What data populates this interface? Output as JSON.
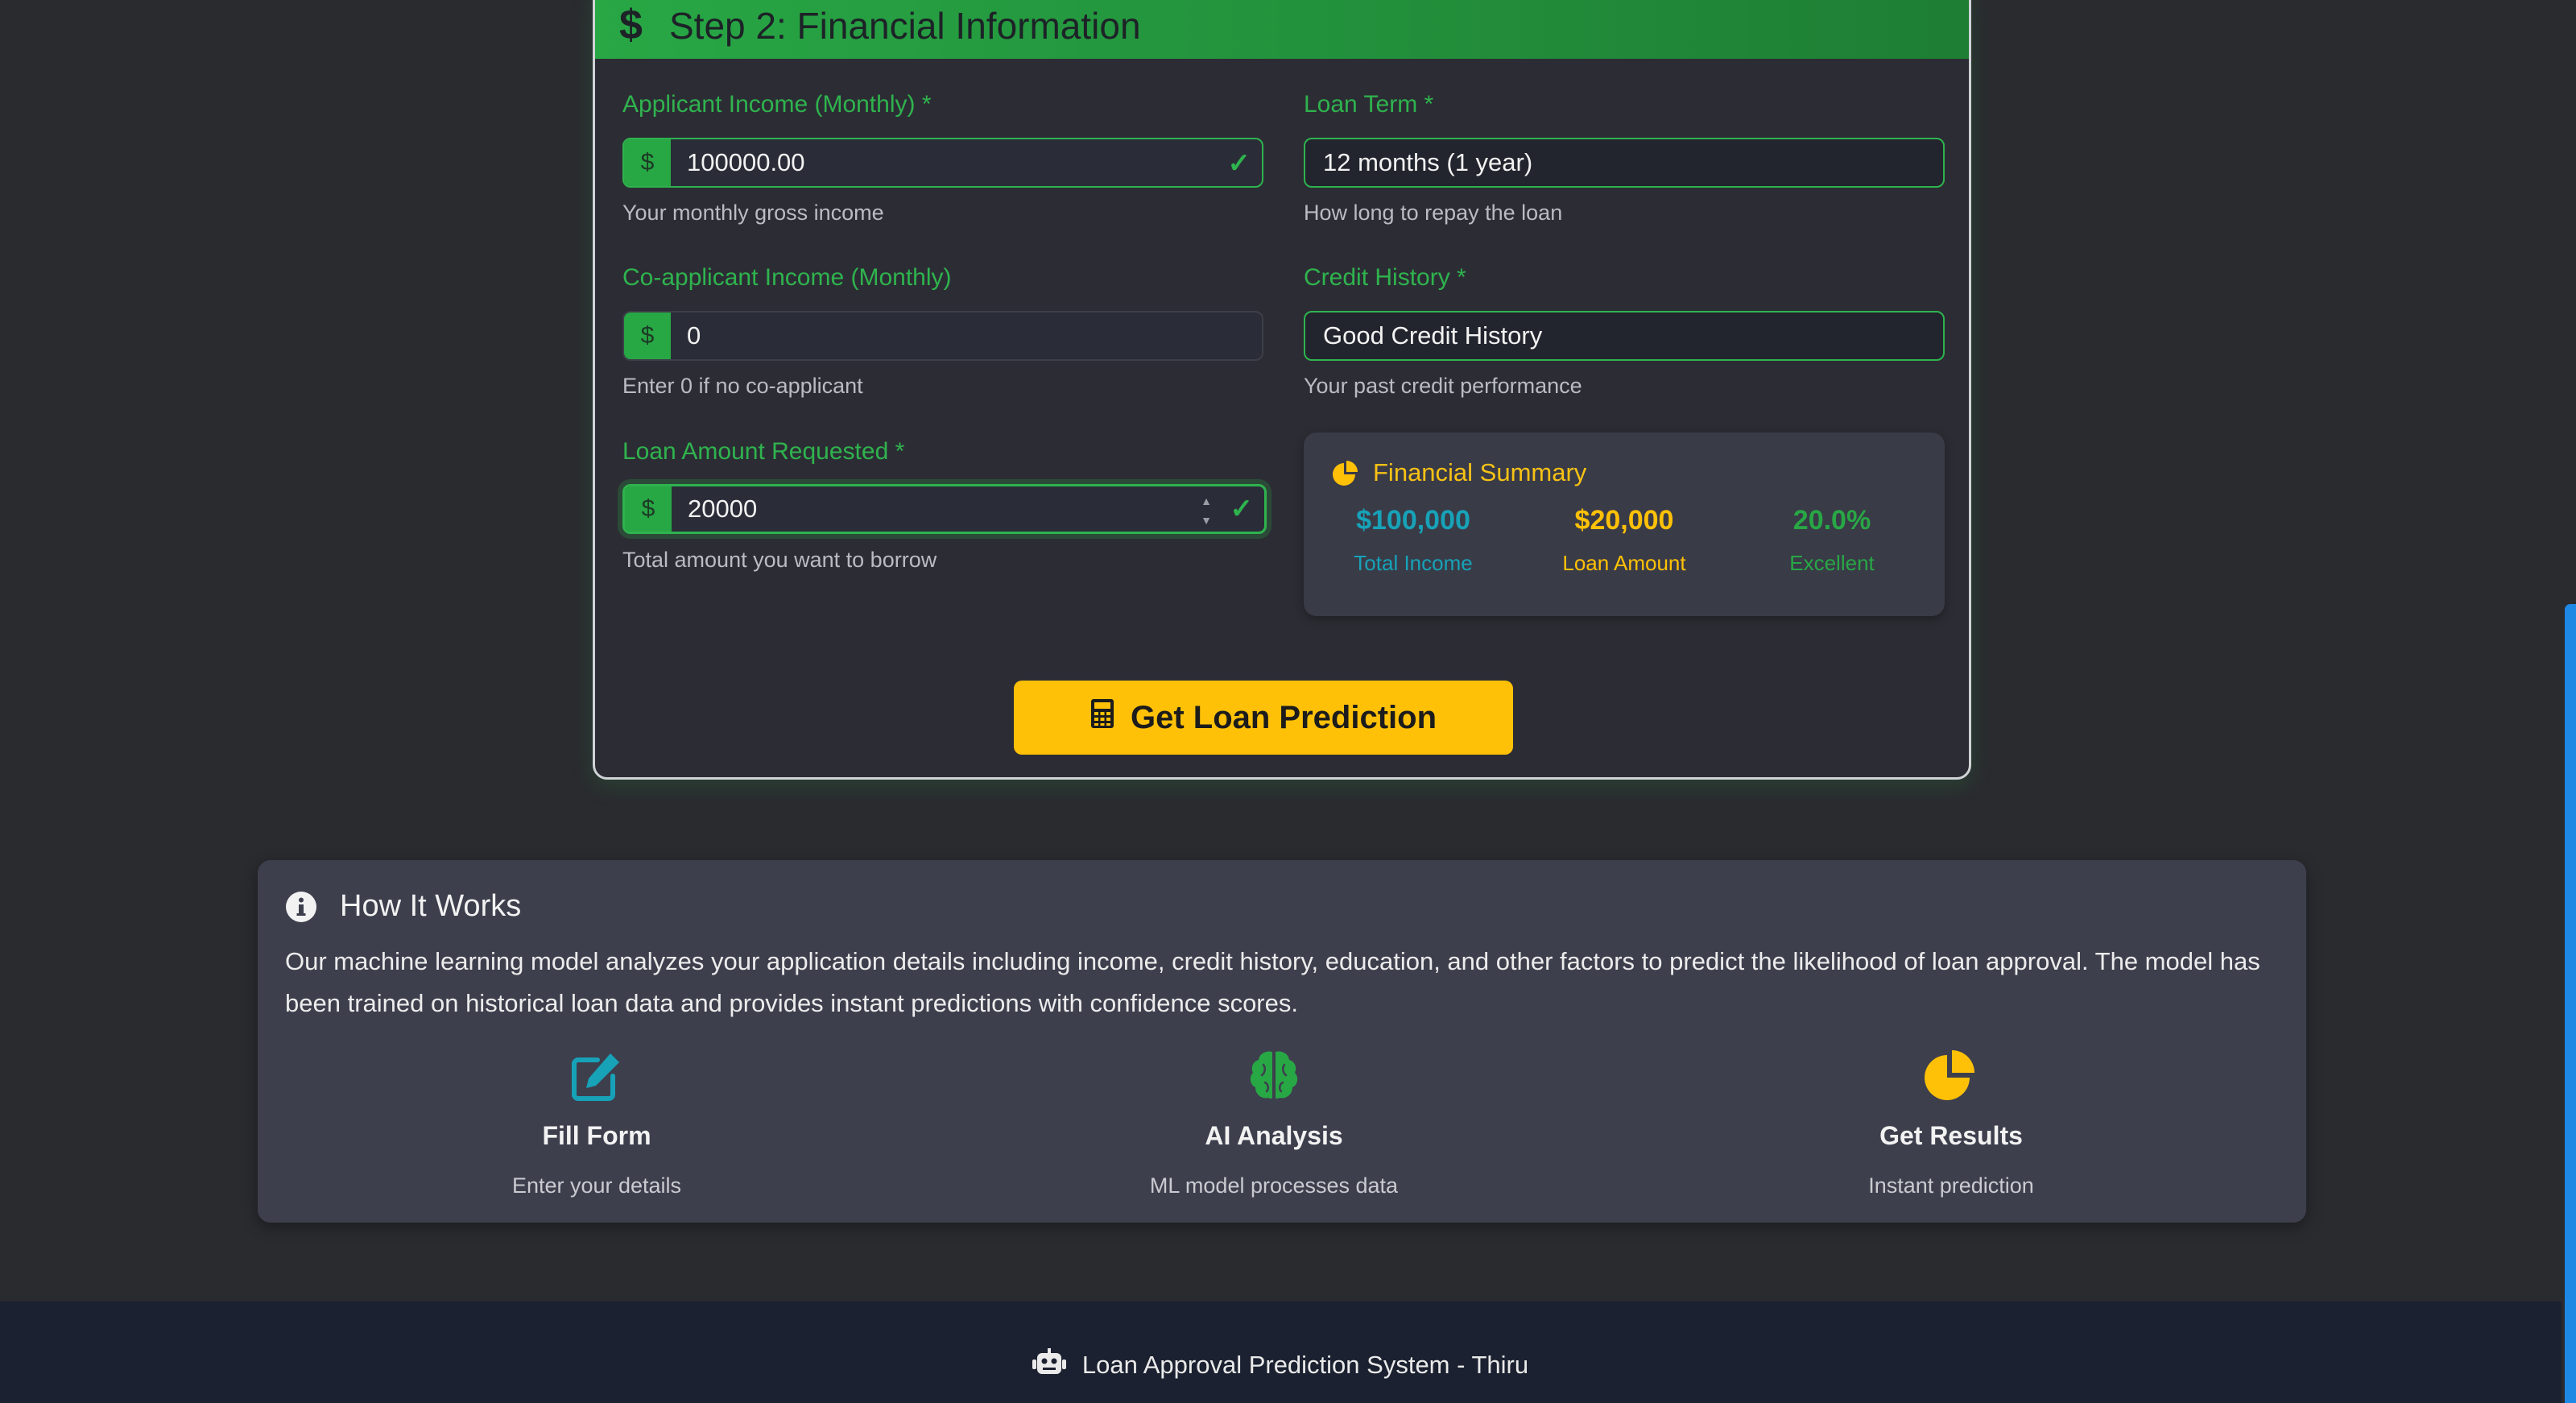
{
  "step": {
    "icon": "dollar-sign-icon",
    "title": "Step 2: Financial Information"
  },
  "form": {
    "applicant_income": {
      "label": "Applicant Income (Monthly) *",
      "prefix": "$",
      "value": "100000.00",
      "help": "Your monthly gross income"
    },
    "coapplicant_income": {
      "label": "Co-applicant Income (Monthly)",
      "prefix": "$",
      "value": "0",
      "help": "Enter 0 if no co-applicant"
    },
    "loan_amount": {
      "label": "Loan Amount Requested *",
      "prefix": "$",
      "value": "20000",
      "help": "Total amount you want to borrow"
    },
    "loan_term": {
      "label": "Loan Term *",
      "selected": "12 months (1 year)",
      "help": "How long to repay the loan"
    },
    "credit_history": {
      "label": "Credit History *",
      "selected": "Good Credit History",
      "help": "Your past credit performance"
    }
  },
  "summary": {
    "title": "Financial Summary",
    "icon": "pie-chart-icon",
    "stats": [
      {
        "value": "$100,000",
        "label": "Total Income",
        "color": "#17a2b8"
      },
      {
        "value": "$20,000",
        "label": "Loan Amount",
        "color": "#ffc107"
      },
      {
        "value": "20.0%",
        "label": "Excellent",
        "color": "#28a745"
      }
    ]
  },
  "predict_button": {
    "label": "Get Loan Prediction",
    "icon": "calculator-icon"
  },
  "how_it_works": {
    "title": "How It Works",
    "icon": "info-circle-icon",
    "text": "Our machine learning model analyzes your application details including income, credit history, education, and other factors to predict the likelihood of loan approval. The model has been trained on historical loan data and provides instant predictions with confidence scores.",
    "steps": [
      {
        "title": "Fill Form",
        "desc": "Enter your details",
        "icon": "edit-icon",
        "color": "#17a2b8"
      },
      {
        "title": "AI Analysis",
        "desc": "ML model processes data",
        "icon": "brain-icon",
        "color": "#28a745"
      },
      {
        "title": "Get Results",
        "desc": "Instant prediction",
        "icon": "pie-chart-icon",
        "color": "#ffc107"
      }
    ]
  },
  "footer": {
    "text": "Loan Approval Prediction System - Thiru",
    "icon": "robot-icon"
  },
  "colors": {
    "accent_green": "#28a745",
    "accent_yellow": "#ffc107",
    "accent_teal": "#17a2b8",
    "scrollbar": "#1e88e5"
  }
}
